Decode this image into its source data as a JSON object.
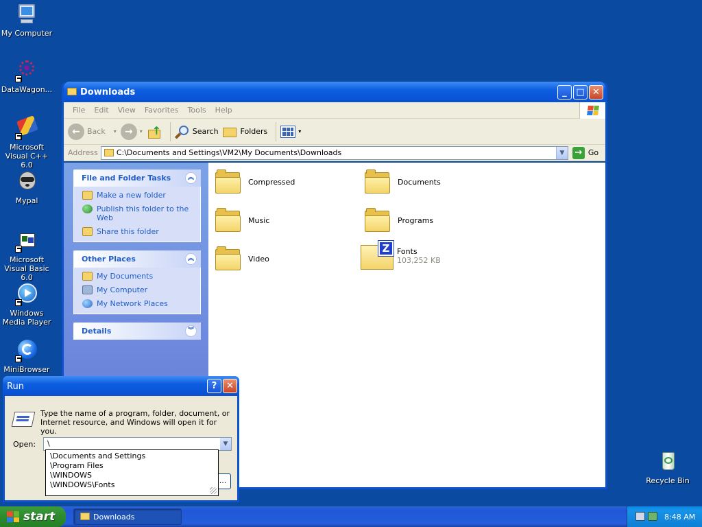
{
  "desktop": {
    "icons": [
      {
        "label": "My Computer"
      },
      {
        "label": "DataWagon..."
      },
      {
        "label": "Microsoft Visual C++ 6.0"
      },
      {
        "label": "Mypal"
      },
      {
        "label": "Microsoft Visual Basic 6.0"
      },
      {
        "label": "Windows Media Player"
      },
      {
        "label": "MiniBrowser"
      },
      {
        "label": "Recycle Bin"
      }
    ]
  },
  "explorer": {
    "title": "Downloads",
    "menu": [
      "File",
      "Edit",
      "View",
      "Favorites",
      "Tools",
      "Help"
    ],
    "toolbar": {
      "back": "Back",
      "search": "Search",
      "folders": "Folders"
    },
    "address": {
      "label": "Address",
      "value": "C:\\Documents and Settings\\VM2\\My Documents\\Downloads",
      "go": "Go"
    },
    "tasks": {
      "title": "File and Folder Tasks",
      "items": [
        "Make a new folder",
        "Publish this folder to the Web",
        "Share this folder"
      ]
    },
    "places": {
      "title": "Other Places",
      "items": [
        "My Documents",
        "My Computer",
        "My Network Places"
      ]
    },
    "details": {
      "title": "Details"
    },
    "files": [
      {
        "name": "Compressed"
      },
      {
        "name": "Documents"
      },
      {
        "name": "Music"
      },
      {
        "name": "Programs"
      },
      {
        "name": "Video"
      },
      {
        "name": "Fonts",
        "size": "103,252 KB"
      }
    ]
  },
  "run": {
    "title": "Run",
    "description": "Type the name of a program, folder, document, or Internet resource, and Windows will open it for you.",
    "open_label": "Open:",
    "open_value": "\\",
    "suggestions": [
      "\\Documents and Settings",
      "\\Program Files",
      "\\WINDOWS",
      "\\WINDOWS\\Fonts"
    ],
    "hidden_button": "..."
  },
  "taskbar": {
    "start": "start",
    "task": "Downloads",
    "time": "8:48 AM"
  },
  "colors": {
    "desktop": "#0a4aa1",
    "titlebar": "#0a50d1",
    "link": "#215dc6"
  }
}
